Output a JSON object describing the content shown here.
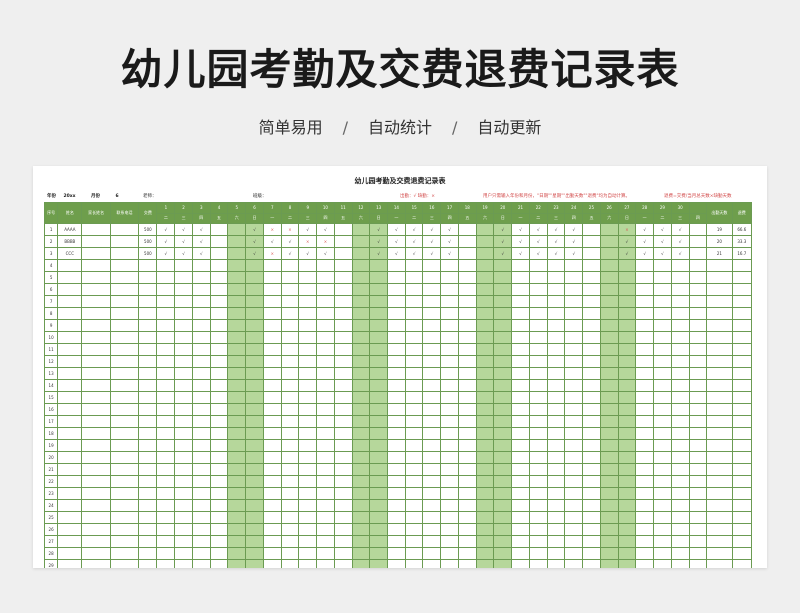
{
  "hero": {
    "title": "幼儿园考勤及交费退费记录表",
    "tags": [
      "简单易用",
      "自动统计",
      "自动更新"
    ],
    "separator": "/"
  },
  "sheet": {
    "title": "幼儿园考勤及交费退费记录表",
    "meta": {
      "year_label": "年份",
      "year_value": "20xx",
      "month_label": "月份",
      "month_value": "6",
      "teacher_label": "老师：",
      "class_label": "班级：",
      "legend": "出勤：√  缺勤：×",
      "instruction": "用户只需输入年份和月份，\"日期\"\"星期\"\"出勤天数\"\"退费\"均为自动计算。",
      "formula": "退费=交费/当月总天数×缺勤天数"
    },
    "headers": {
      "index": "序号",
      "name": "姓名",
      "parent": "家长姓名",
      "phone": "联系电话",
      "fee": "交费",
      "attendance_days": "出勤天数",
      "refund": "退费"
    },
    "days": [
      "1",
      "2",
      "3",
      "4",
      "5",
      "6",
      "7",
      "8",
      "9",
      "10",
      "11",
      "12",
      "13",
      "14",
      "15",
      "16",
      "17",
      "18",
      "19",
      "20",
      "21",
      "22",
      "23",
      "24",
      "25",
      "26",
      "27",
      "28",
      "29",
      "30"
    ],
    "weekdays": [
      "二",
      "三",
      "四",
      "五",
      "六",
      "日",
      "一",
      "二",
      "三",
      "四",
      "五",
      "六",
      "日",
      "一",
      "二",
      "三",
      "四",
      "五",
      "六",
      "日",
      "一",
      "二",
      "三",
      "四",
      "五",
      "六",
      "日",
      "一",
      "二",
      "三",
      "四"
    ],
    "rows": [
      {
        "index": "1",
        "name": "AAAA",
        "parent": "",
        "phone": "",
        "fee": "500",
        "marks": [
          "√",
          "√",
          "√",
          "",
          "",
          "√",
          "×",
          "×",
          "√",
          "√",
          "",
          "",
          "√",
          "√",
          "√",
          "√",
          "√",
          "",
          "",
          "√",
          "√",
          "√",
          "√",
          "√",
          "",
          "",
          "×",
          "√",
          "√",
          "√",
          ""
        ],
        "attendance": "19",
        "refund": "66.6"
      },
      {
        "index": "2",
        "name": "BBBB",
        "parent": "",
        "phone": "",
        "fee": "500",
        "marks": [
          "√",
          "√",
          "√",
          "",
          "",
          "√",
          "√",
          "√",
          "×",
          "×",
          "",
          "",
          "√",
          "√",
          "√",
          "√",
          "√",
          "",
          "",
          "√",
          "√",
          "√",
          "√",
          "√",
          "",
          "",
          "√",
          "√",
          "√",
          "√",
          ""
        ],
        "attendance": "20",
        "refund": "33.3"
      },
      {
        "index": "3",
        "name": "CCC",
        "parent": "",
        "phone": "",
        "fee": "500",
        "marks": [
          "√",
          "√",
          "√",
          "",
          "",
          "√",
          "×",
          "√",
          "√",
          "√",
          "",
          "",
          "√",
          "√",
          "√",
          "√",
          "√",
          "",
          "",
          "√",
          "√",
          "√",
          "√",
          "√",
          "",
          "",
          "√",
          "√",
          "√",
          "√",
          ""
        ],
        "attendance": "21",
        "refund": "16.7"
      }
    ],
    "empty_row_indices": [
      "4",
      "5",
      "6",
      "7",
      "8",
      "9",
      "10",
      "11",
      "12",
      "13",
      "14",
      "15",
      "16",
      "17",
      "18",
      "19",
      "20",
      "21",
      "22",
      "23",
      "24",
      "25",
      "26",
      "27",
      "28",
      "29"
    ]
  }
}
